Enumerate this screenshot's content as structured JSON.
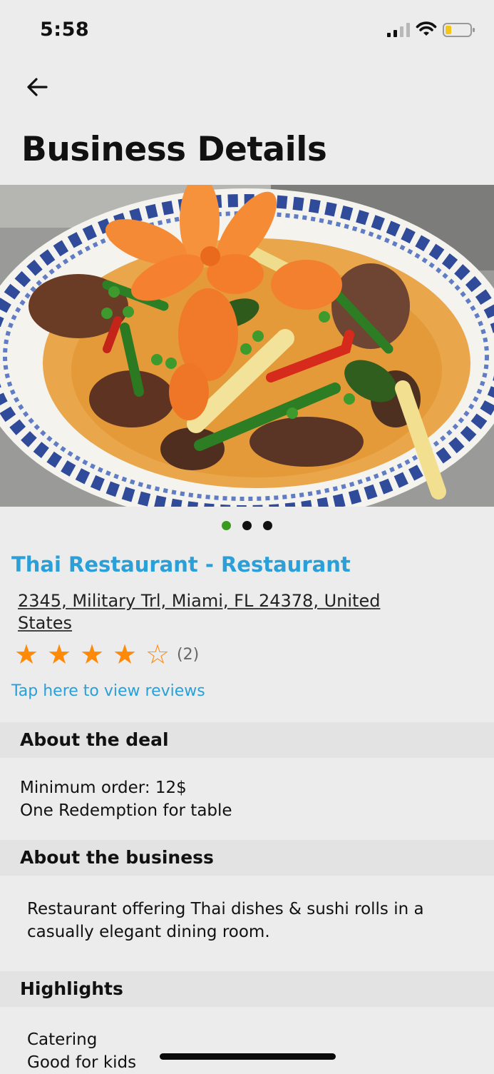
{
  "status_bar": {
    "time": "5:58"
  },
  "header": {
    "title": "Business Details"
  },
  "carousel": {
    "page_count": 3,
    "active_index": 0
  },
  "business": {
    "name": "Thai Restaurant - Restaurant",
    "address": "2345, Military Trl, Miami, FL  24378, United States",
    "rating": 4,
    "max_rating": 5,
    "review_count": "(2)",
    "reviews_link": "Tap here to view reviews"
  },
  "sections": {
    "deal": {
      "title": "About the deal",
      "lines": [
        "Minimum order: 12$",
        "One Redemption for table"
      ]
    },
    "business": {
      "title": "About the business",
      "text": "Restaurant offering Thai dishes & sushi rolls in a casually elegant dining room."
    },
    "highlights": {
      "title": "Highlights",
      "items": [
        "Catering",
        "Good for kids"
      ]
    }
  },
  "colors": {
    "accent": "#2a9fd8",
    "star": "#ff8a0a",
    "active_dot": "#3a9a1f",
    "background": "#ebeceb",
    "section_header": "#e2e3e2"
  }
}
